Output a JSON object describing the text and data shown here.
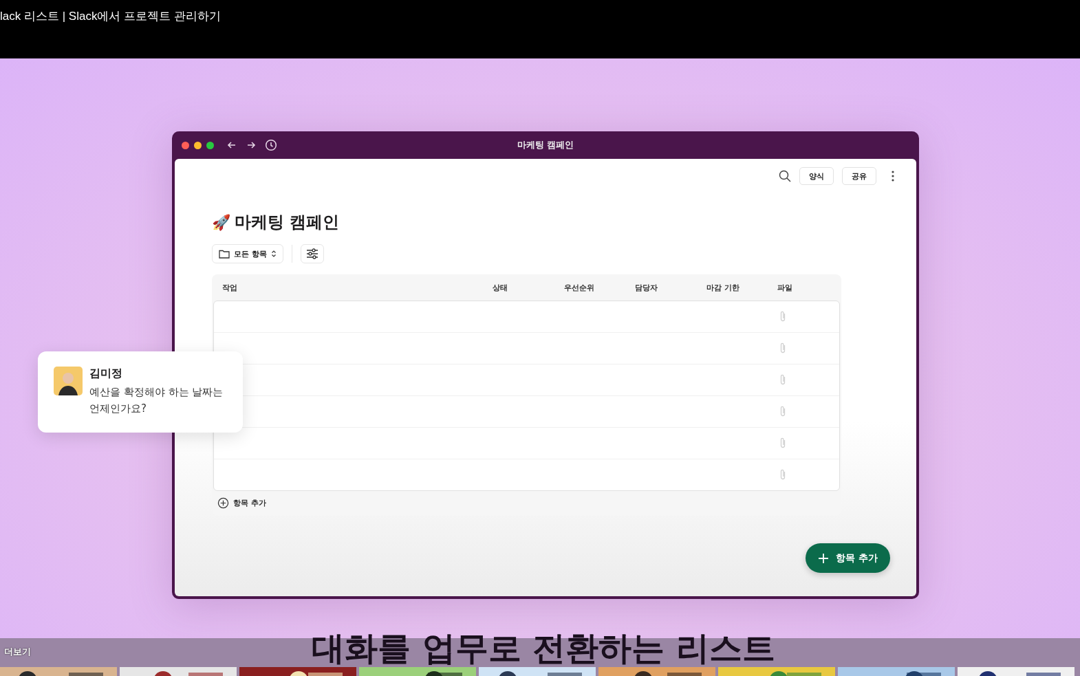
{
  "video_title": "lack 리스트 | Slack에서 프로젝트 관리하기",
  "window": {
    "title": "마케팅 캠페인"
  },
  "toolbar": {
    "buttons": [
      "양식",
      "공유"
    ]
  },
  "list": {
    "title_emoji": "🚀",
    "title": "마케팅 캠페인",
    "view": "모든 항목",
    "columns": [
      "작업",
      "상태",
      "우선순위",
      "담당자",
      "마감 기한",
      "파일"
    ],
    "rows": [
      {
        "file_icon": true
      },
      {
        "file_icon": true
      },
      {
        "file_icon": true
      },
      {
        "file_icon": true
      },
      {
        "file_icon": true
      },
      {
        "file_icon": true
      }
    ],
    "add_item": "항목 추가"
  },
  "fab": {
    "label": "항목 추가"
  },
  "message": {
    "sender": "김미정",
    "text": "예산을 확정해야 하는 날짜는 언제인가요?"
  },
  "caption": "대화를 업무로 전환하는 리스트",
  "end_bar": {
    "label": "더보기"
  }
}
